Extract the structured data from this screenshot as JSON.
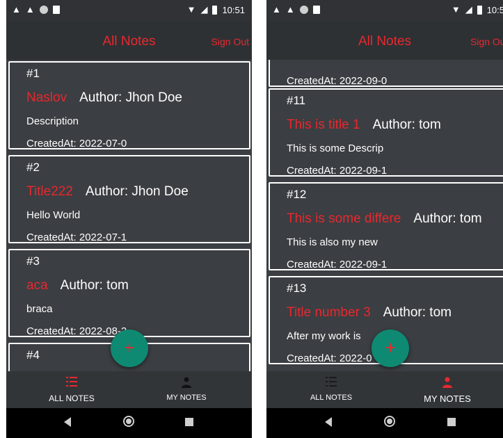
{
  "colors": {
    "accent": "#e8282e",
    "fab": "#0e8a72",
    "background": "#3b3e42",
    "appbar": "#2e3134"
  },
  "screens": [
    {
      "status": {
        "time": "10:51",
        "left_icons": [
          "warning-icon",
          "warning-icon",
          "circle-icon",
          "sd-card-icon"
        ],
        "right_icons": [
          "wifi-icon",
          "signal-icon",
          "battery-icon"
        ]
      },
      "appbar": {
        "title": "All Notes",
        "sign_out": "Sign Out"
      },
      "notes": [
        {
          "number": "#1",
          "title": "Naslov",
          "author": "Author: Jhon Doe",
          "description": "Description",
          "created": "CreatedAt: 2022-07-0"
        },
        {
          "number": "#2",
          "title": "Title222",
          "author": "Author: Jhon Doe",
          "description": "Hello World",
          "created": "CreatedAt: 2022-07-1"
        },
        {
          "number": "#3",
          "title": "aca",
          "author": "Author: tom",
          "description": "braca",
          "created": "CreatedAt: 2022-08-2"
        },
        {
          "number": "#4",
          "title": "",
          "author": "",
          "description": "",
          "created": ""
        }
      ],
      "fab_symbol": "+",
      "nav": {
        "all_notes": "ALL NOTES",
        "my_notes": "MY NOTES",
        "active": "all_notes"
      }
    },
    {
      "status": {
        "time": "10:5",
        "left_icons": [
          "warning-icon",
          "warning-icon",
          "circle-icon",
          "sd-card-icon"
        ],
        "right_icons": [
          "wifi-icon",
          "signal-icon",
          "battery-icon"
        ]
      },
      "appbar": {
        "title": "All Notes",
        "sign_out": "Sign Ou"
      },
      "notes": [
        {
          "number": "",
          "title": "",
          "author": "",
          "description": "",
          "created": "CreatedAt: 2022-09-0"
        },
        {
          "number": "#11",
          "title": "This is title 1",
          "author": "Author: tom",
          "description": "This is some Descrip",
          "created": "CreatedAt: 2022-09-1"
        },
        {
          "number": "#12",
          "title": "This is some differe",
          "author": "Author: tom",
          "description": "This is also my new",
          "created": "CreatedAt: 2022-09-1"
        },
        {
          "number": "#13",
          "title": "Title number 3",
          "author": "Author: tom",
          "description": "After my work is",
          "created": "CreatedAt: 2022-0"
        }
      ],
      "fab_symbol": "+",
      "nav": {
        "all_notes": "ALL NOTES",
        "my_notes": "MY NOTES",
        "active": "my_notes"
      }
    }
  ]
}
